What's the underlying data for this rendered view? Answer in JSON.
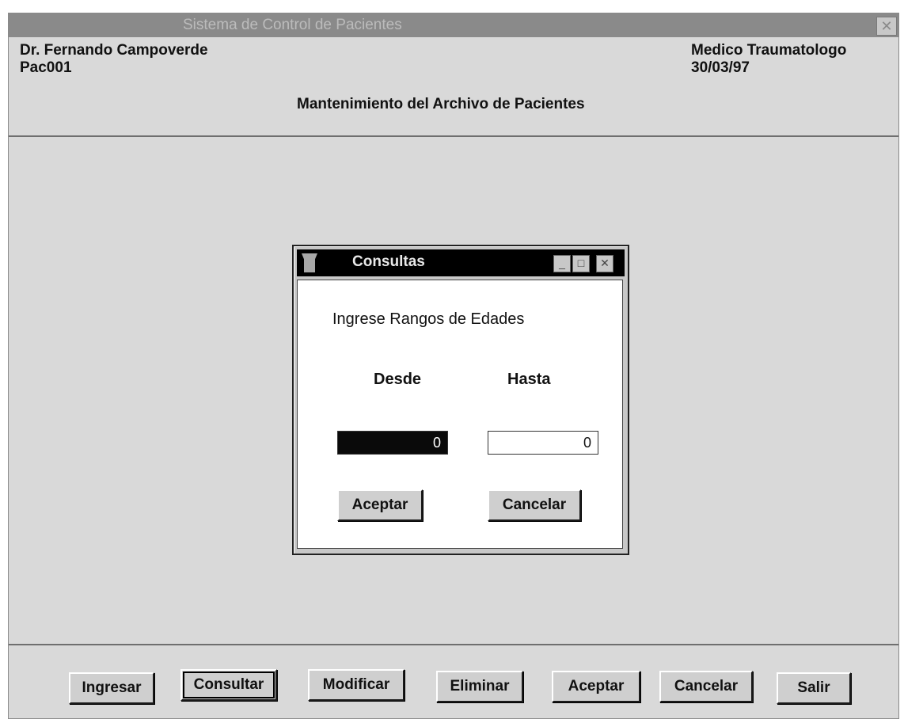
{
  "window": {
    "title": "Sistema de Control de Pacientes",
    "close_glyph": "✕"
  },
  "header": {
    "doctor": "Dr. Fernando Campoverde",
    "code": "Pac001",
    "specialty": "Medico Traumatologo",
    "date": "30/03/97",
    "screen_title": "Mantenimiento del Archivo de Pacientes"
  },
  "dialog": {
    "title": "Consultas",
    "prompt": "Ingrese Rangos de Edades",
    "from_label": "Desde",
    "to_label": "Hasta",
    "from_value": "0",
    "to_value": "0",
    "accept_label": "Aceptar",
    "cancel_label": "Cancelar",
    "minimize_glyph": "_",
    "maximize_glyph": "□",
    "close_glyph": "✕"
  },
  "toolbar": {
    "ingresar": "Ingresar",
    "consultar": "Consultar",
    "modificar": "Modificar",
    "eliminar": "Eliminar",
    "aceptar": "Aceptar",
    "cancelar": "Cancelar",
    "salir": "Salir"
  },
  "icons": {
    "window_close": "close-icon",
    "dialog_system": "system-menu-icon",
    "dialog_minimize": "minimize-icon",
    "dialog_maximize": "maximize-icon",
    "dialog_close": "close-icon"
  },
  "colors": {
    "titlebar": "#8a8a8a",
    "background": "#d9d9d9",
    "dialog_titlebar": "#000000",
    "selected_field": "#0a0a0a"
  }
}
